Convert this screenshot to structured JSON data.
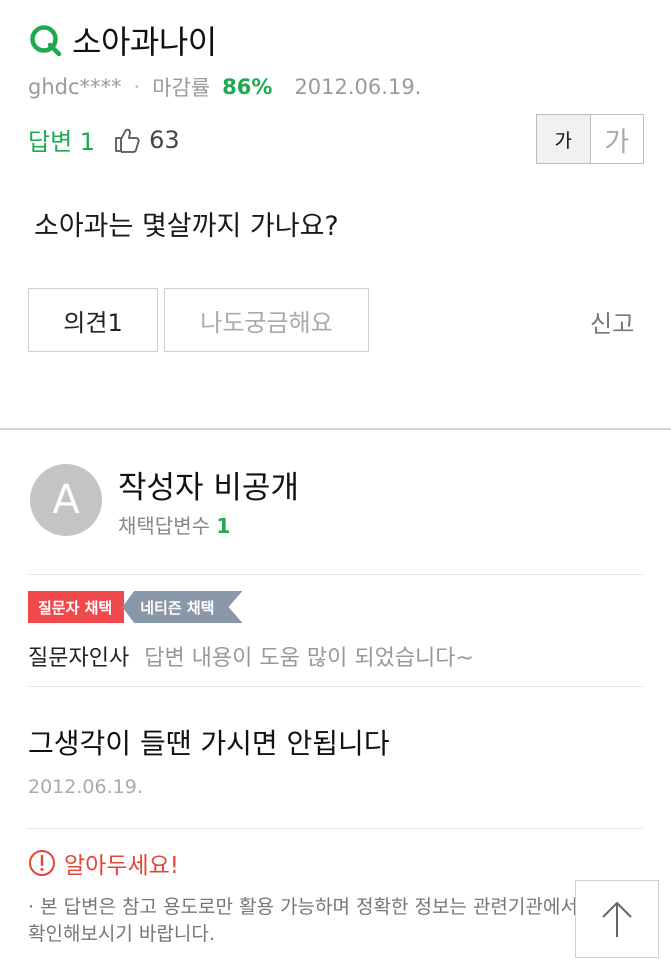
{
  "question": {
    "title": "소아과나이",
    "user": "ghdc****",
    "deadline_label": "마감률",
    "deadline_rate": "86%",
    "date": "2012.06.19.",
    "answer_label": "답변 1",
    "like_count": "63",
    "font_small_label": "가",
    "font_large_label": "가",
    "body": "소아과는 몇살까지 가나요?",
    "opinion_button": "의견1",
    "curious_button": "나도궁금해요",
    "report_label": "신고"
  },
  "answer": {
    "avatar_letter": "A",
    "author": "작성자 비공개",
    "chosen_label": "채택답변수",
    "chosen_count": "1",
    "badge_asker": "질문자 채택",
    "badge_netizen": "네티즌 채택",
    "greeting_label": "질문자인사",
    "greeting_message": "답변 내용이 도움 많이 되었습니다~",
    "title": "그생각이 들땐 가시면 안됩니다",
    "date": "2012.06.19."
  },
  "notice": {
    "title": "알아두세요!",
    "body": "· 본 답변은 참고 용도로만 활용 가능하며 정확한 정보는 관련기관에서 확인해보시기 바랍니다."
  },
  "icons": {
    "question_mark": "q-icon",
    "like": "thumbs-up-icon",
    "alert": "alert-circle-icon",
    "scroll_top": "arrow-up-icon"
  },
  "colors": {
    "accent_green": "#1faa52",
    "badge_red": "#f0494b",
    "badge_gray": "#8a97a8",
    "alert_red": "#e0473a"
  }
}
